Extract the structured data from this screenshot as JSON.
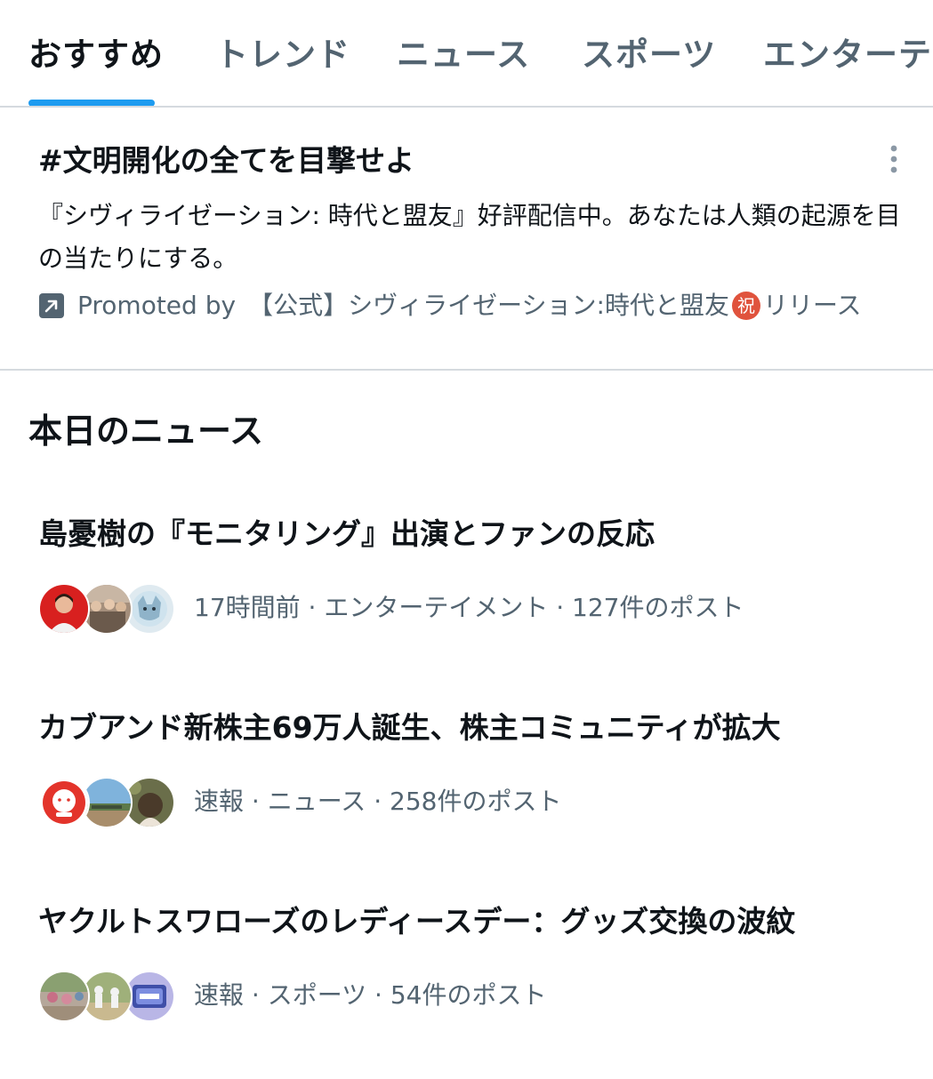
{
  "tabs": [
    {
      "label": "おすすめ",
      "active": true
    },
    {
      "label": "トレンド",
      "active": false
    },
    {
      "label": "ニュース",
      "active": false
    },
    {
      "label": "スポーツ",
      "active": false
    },
    {
      "label": "エンターテイ",
      "active": false
    }
  ],
  "promoted": {
    "title": "#文明開化の全てを目撃せよ",
    "description": "『シヴィライゼーション: 時代と盟友』好評配信中。あなたは人類の起源を目の当たりにする。",
    "promoted_by_label": "Promoted by",
    "advertiser_name": "【公式】シヴィライゼーション:時代と盟友",
    "advertiser_badge": "祝",
    "advertiser_suffix": "リリース",
    "more_icon": "more-vertical-icon",
    "promo_icon": "promoted-arrow-icon"
  },
  "news_section": {
    "title": "本日のニュース",
    "items": [
      {
        "headline": "島憂樹の『モニタリング』出演とファンの反応",
        "meta": "17時間前 · エンターテイメント · 127件のポスト"
      },
      {
        "headline": "カブアンド新株主69万人誕生、株主コミュニティが拡大",
        "meta": "速報 · ニュース · 258件のポスト"
      },
      {
        "headline": "ヤクルトスワローズのレディースデー：グッズ交換の波紋",
        "meta": "速報 · スポーツ · 54件のポスト"
      }
    ]
  },
  "colors": {
    "accent": "#1d9bf0",
    "text_primary": "#0f1419",
    "text_secondary": "#536471",
    "divider": "#d5dadf"
  }
}
